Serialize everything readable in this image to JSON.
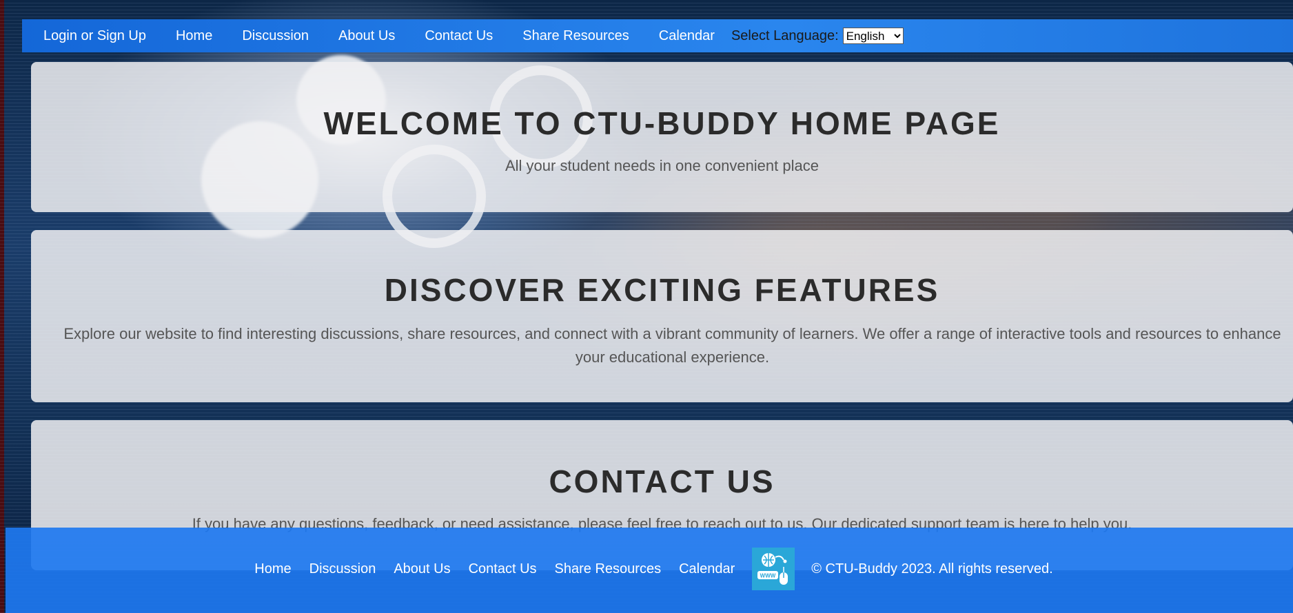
{
  "nav": {
    "links": [
      "Login or Sign Up",
      "Home",
      "Discussion",
      "About Us",
      "Contact Us",
      "Share Resources",
      "Calendar"
    ],
    "language_label": "Select Language:",
    "language_selected": "English"
  },
  "welcome": {
    "title": "WELCOME TO CTU-BUDDY HOME PAGE",
    "subtitle": "All your student needs in one convenient place"
  },
  "features": {
    "title": "DISCOVER EXCITING FEATURES",
    "text": "Explore our website to find interesting discussions, share resources, and connect with a vibrant community of learners. We offer a range of interactive tools and resources to enhance your educational experience."
  },
  "contact": {
    "title": "CONTACT US",
    "text": "If you have any questions, feedback, or need assistance, please feel free to reach out to us. Our dedicated support team is here to help you."
  },
  "footer": {
    "links": [
      "Home",
      "Discussion",
      "About Us",
      "Contact Us",
      "Share Resources",
      "Calendar"
    ],
    "logo_icon": "www-globe-mouse-icon",
    "logo_text": "WWW",
    "copyright": "© CTU-Buddy 2023. All rights reserved."
  },
  "colors": {
    "nav_bar": "#1e73dd",
    "footer_bar": "#1e78f0",
    "panel_bg": "#f0f0f2",
    "heading": "#2b2b2b"
  }
}
